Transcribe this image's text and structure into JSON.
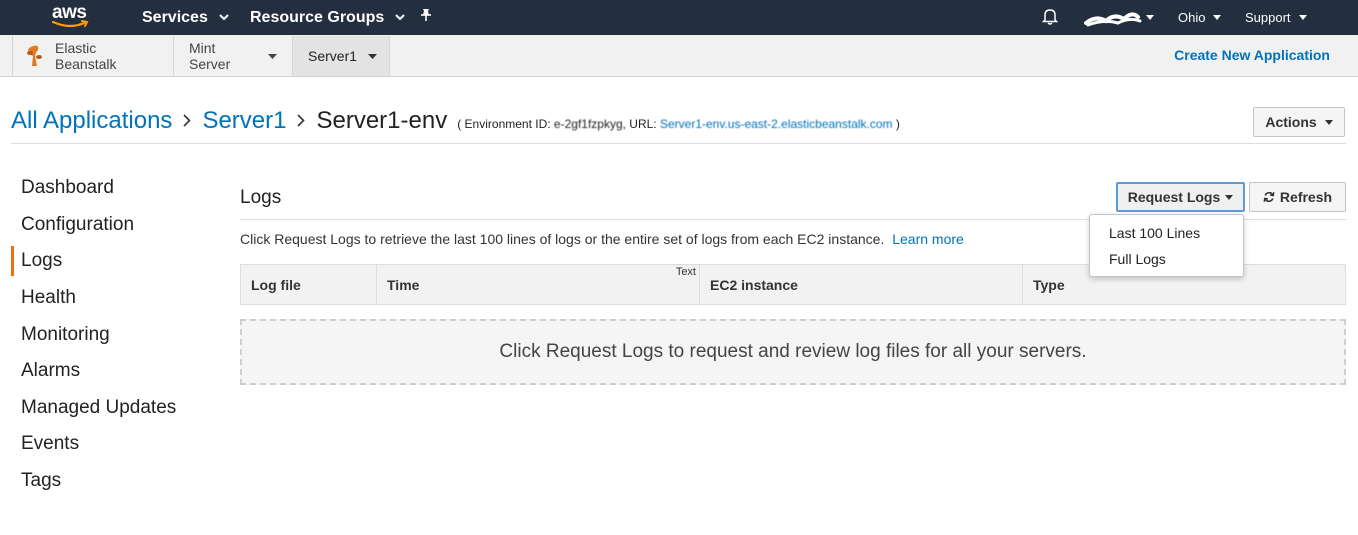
{
  "colors": {
    "topnav_bg": "#232f3e",
    "link": "#0073bb",
    "active_marker": "#ec7211"
  },
  "topnav": {
    "logo": "aws",
    "services": "Services",
    "resource_groups": "Resource Groups",
    "pin_icon": "pin-icon",
    "bell_icon": "bell-icon",
    "region": "Ohio",
    "support": "Support"
  },
  "servicebar": {
    "service_name": "Elastic Beanstalk",
    "app_menu": "Mint Server",
    "env_menu": "Server1",
    "create_app": "Create New Application"
  },
  "breadcrumb": {
    "all_apps": "All Applications",
    "app": "Server1",
    "env": "Server1-env",
    "env_info_open": "( Environment ID: ",
    "env_id": "e-2gf1fzpkyg,",
    "url_label": " URL: ",
    "url": "Server1-env.us-east-2.elasticbeanstalk.com",
    "env_info_close": " )"
  },
  "actions_label": "Actions",
  "sidenav": {
    "items": [
      "Dashboard",
      "Configuration",
      "Logs",
      "Health",
      "Monitoring",
      "Alarms",
      "Managed Updates",
      "Events",
      "Tags"
    ],
    "active": "Logs"
  },
  "logs": {
    "title": "Logs",
    "request_logs": "Request Logs",
    "refresh": "Refresh",
    "description": "Click Request Logs to retrieve the last 100 lines of logs or the entire set of logs from each EC2 instance.",
    "learn_more": "Learn more",
    "columns": [
      "Log file",
      "Time",
      "EC2 instance",
      "Type"
    ],
    "time_note": "Text",
    "empty_message": "Click Request Logs to request and review log files for all your servers.",
    "dropdown": [
      "Last 100 Lines",
      "Full Logs"
    ]
  }
}
